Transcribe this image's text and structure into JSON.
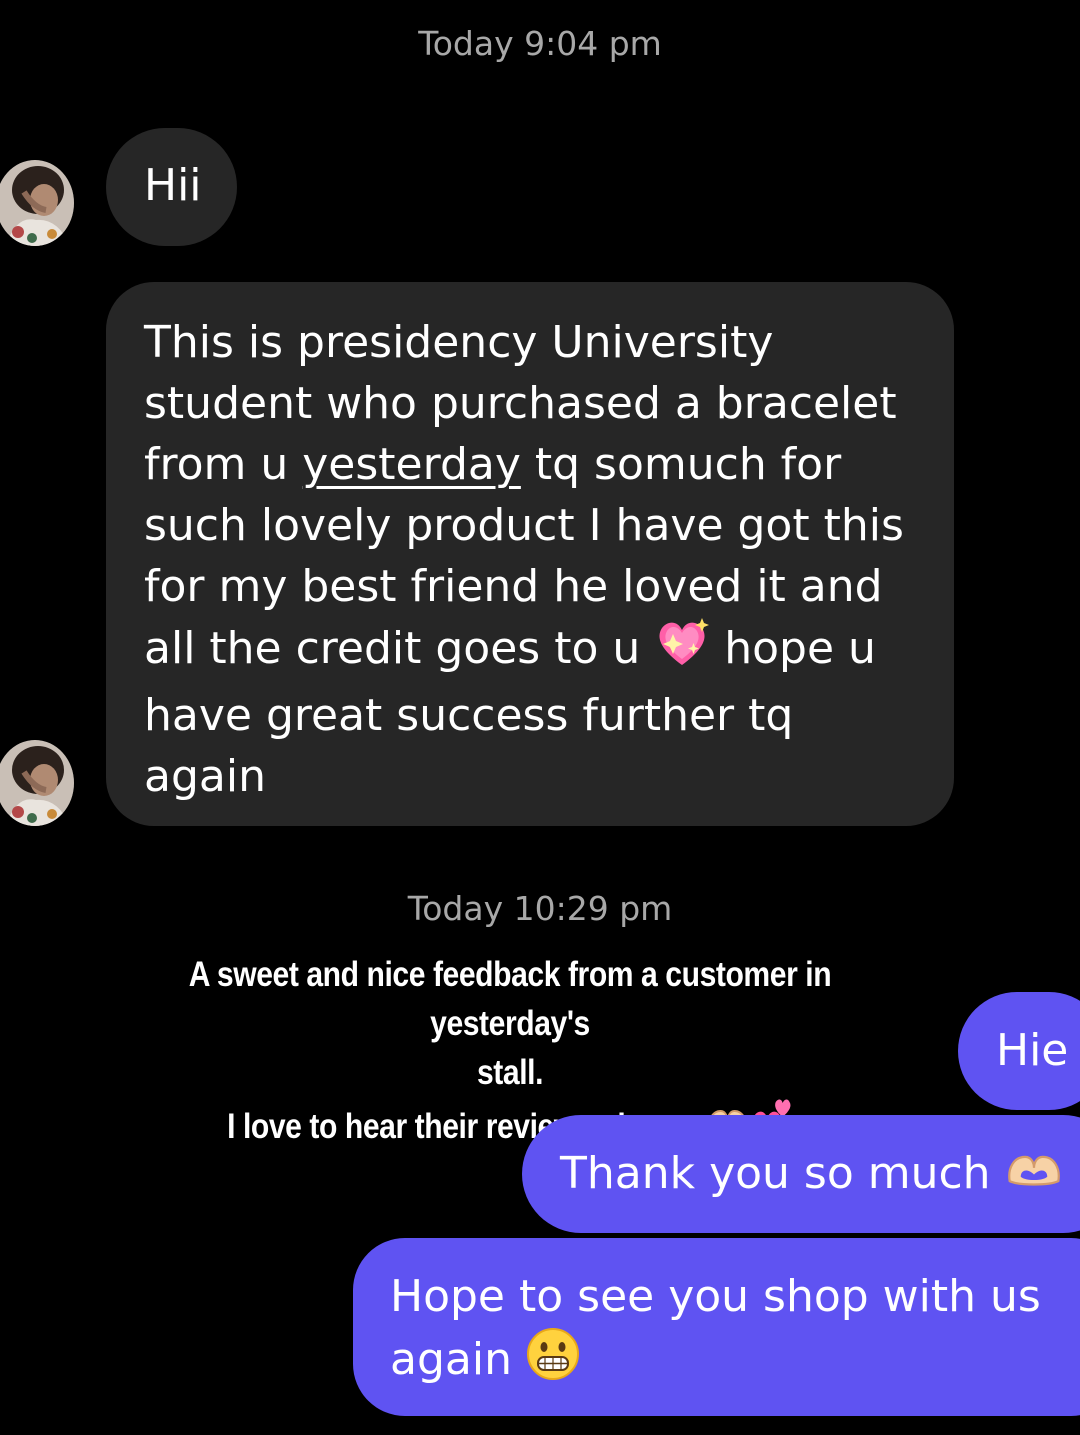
{
  "timestamps": {
    "first": "Today 9:04 pm",
    "second": "Today 10:29 pm"
  },
  "incoming": {
    "msg1": "Hii",
    "msg2": {
      "part1": "This is presidency University student who purchased a bracelet from u ",
      "link_word": "yesterday",
      "part2": " tq somuch for such lovely product I have got this for my best friend he loved it and all the credit goes to u ",
      "part3": " hope u have great success further tq again"
    }
  },
  "caption": {
    "line1": "A sweet and nice feedback from a customer in yesterday's",
    "line2": "stall.",
    "line3": "I love to hear their reviews always"
  },
  "outgoing": {
    "msg1": "Hie",
    "msg2": "Thank you so much",
    "msg3_line1": "Hope to see you shop with us",
    "msg3_line2": "again"
  },
  "colors": {
    "background": "#000000",
    "incoming_bubble": "#262626",
    "outgoing_bubble": "#5f53f2",
    "timestamp": "#a8a8a8"
  },
  "icons": [
    "sparkling-heart-icon",
    "heart-hands-icon",
    "two-hearts-icon",
    "grinning-face-icon",
    "avatar-photo"
  ]
}
